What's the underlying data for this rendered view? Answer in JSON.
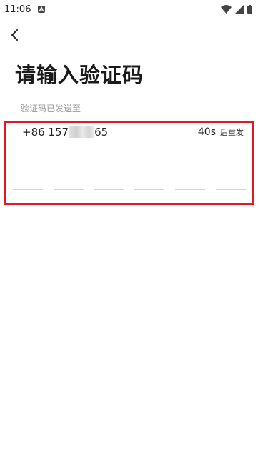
{
  "status_bar": {
    "time": "11:06",
    "icons": [
      "notification-a-icon",
      "wifi-icon",
      "cellular-signal-icon",
      "battery-icon"
    ]
  },
  "nav": {
    "back_icon": "chevron-left-icon"
  },
  "title": "请输入验证码",
  "subtitle": "验证码已发送至",
  "phone": {
    "prefix": "+86 157",
    "suffix": "65"
  },
  "resend": {
    "countdown": "40s",
    "label": "后重发"
  },
  "code_slots": [
    "",
    "",
    "",
    "",
    "",
    ""
  ],
  "colors": {
    "highlight": "#e0192a",
    "text": "#1a1a1a",
    "muted": "#9a9a9a",
    "slot_line": "#d4d4d4"
  }
}
